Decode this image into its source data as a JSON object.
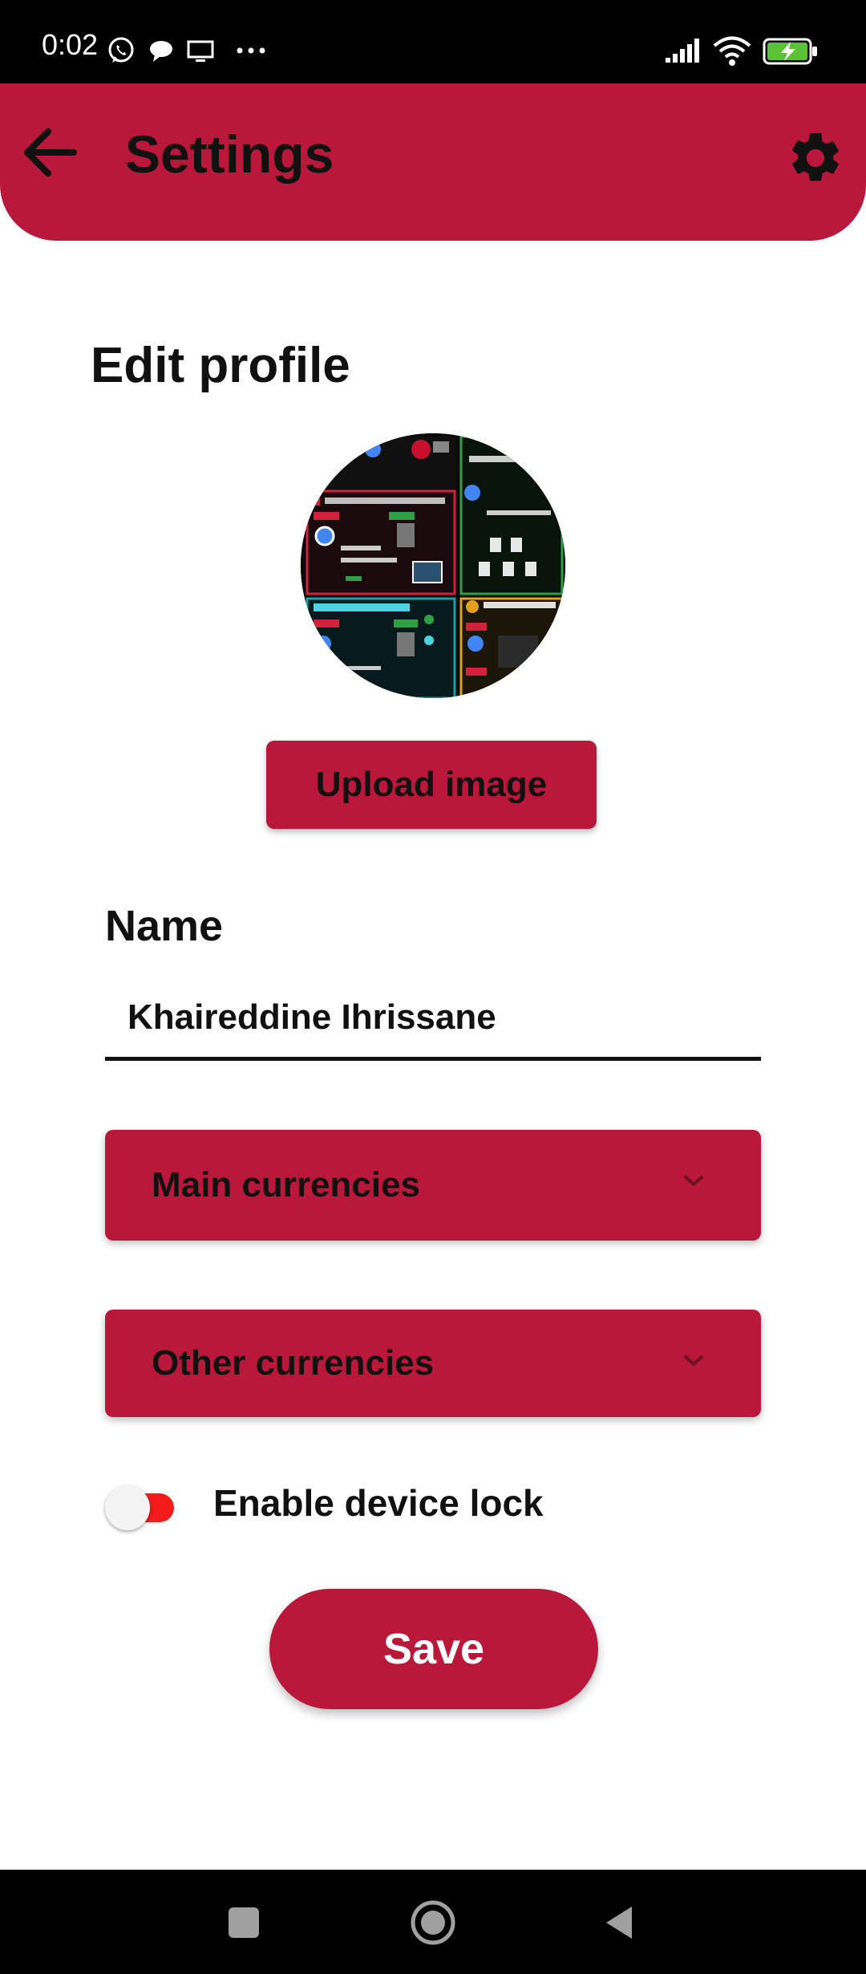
{
  "status_bar": {
    "time": "0:02",
    "icons": [
      "whatsapp-icon",
      "chat-bubble-icon",
      "screen-icon",
      "more-dots-icon",
      "signal-icon",
      "wifi-icon",
      "battery-charging-icon"
    ]
  },
  "app_bar": {
    "title": "Settings",
    "back_icon": "arrow-left-icon",
    "settings_icon": "gear-icon",
    "color": "#BA183A"
  },
  "profile": {
    "section_title": "Edit profile",
    "avatar_icon": "profile-image",
    "upload_label": "Upload image"
  },
  "name_field": {
    "label": "Name",
    "value": "Khaireddine Ihrissane"
  },
  "dropdowns": [
    {
      "label": "Main currencies",
      "icon": "chevron-down-icon"
    },
    {
      "label": "Other currencies",
      "icon": "chevron-down-icon"
    }
  ],
  "device_lock": {
    "label": "Enable device lock",
    "enabled": false,
    "track_color": "#F21C1C"
  },
  "save": {
    "label": "Save"
  },
  "nav_bar": {
    "icons": [
      "recents-square-icon",
      "home-circle-icon",
      "back-triangle-icon"
    ]
  }
}
